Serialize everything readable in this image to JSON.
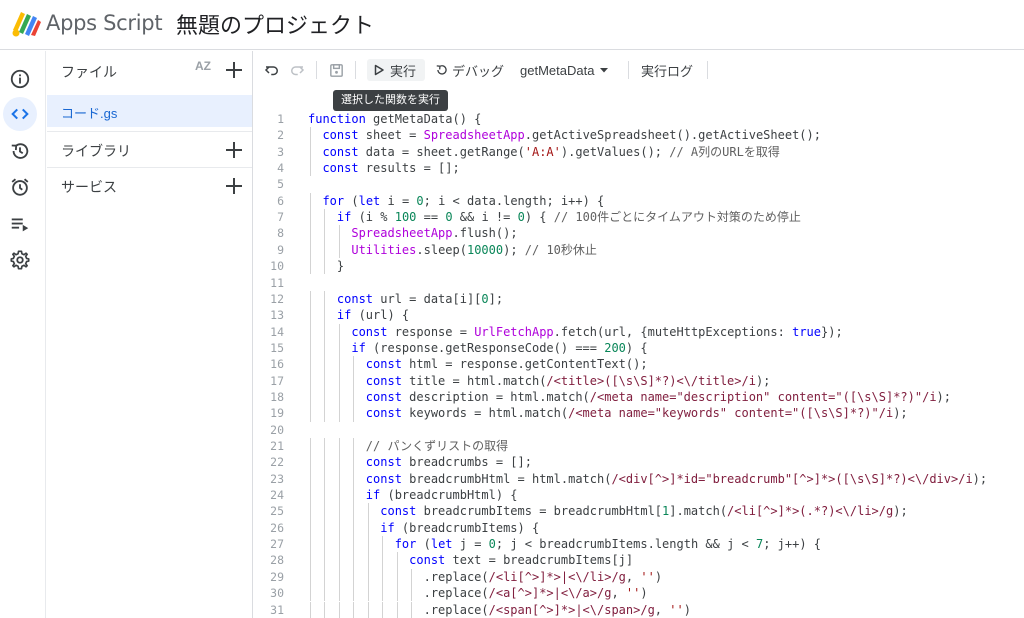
{
  "header": {
    "app_name": "Apps Script",
    "project_title": "無題のプロジェクト"
  },
  "rail": {
    "items": [
      "info-icon",
      "code-icon",
      "history-icon",
      "triggers-icon",
      "executions-icon",
      "settings-icon"
    ],
    "active": "code-icon"
  },
  "files_panel": {
    "title": "ファイル",
    "sort_icon_text": "AZ",
    "files": [
      "コード.gs"
    ],
    "sections": [
      {
        "label": "ライブラリ"
      },
      {
        "label": "サービス"
      }
    ]
  },
  "toolbar": {
    "run_label": "実行",
    "debug_label": "デバッグ",
    "function_name": "getMetaData",
    "log_label": "実行ログ",
    "tooltip": "選択した関数を実行"
  },
  "colors": {
    "accent": "#1a73e8",
    "selected_bg": "#e8f0fe",
    "keyword": "#0000ff",
    "string": "#a31515",
    "comment": "#616161"
  },
  "code": {
    "line_numbers": [
      "1",
      "2",
      "3",
      "4",
      "5",
      "6",
      "7",
      "8",
      "9",
      "10",
      "11",
      "12",
      "13",
      "14",
      "15",
      "16",
      "17",
      "18",
      "19",
      "20",
      "21",
      "22",
      "23",
      "24",
      "25",
      "26",
      "27",
      "28",
      "29",
      "30",
      "31"
    ],
    "lines": [
      "function getMetaData() {",
      "  const sheet = SpreadsheetApp.getActiveSpreadsheet().getActiveSheet();",
      "  const data = sheet.getRange('A:A').getValues(); // A列のURLを取得",
      "  const results = [];",
      "",
      "  for (let i = 0; i < data.length; i++) {",
      "    if (i % 100 == 0 && i != 0) { // 100件ごとにタイムアウト対策のため停止",
      "      SpreadsheetApp.flush();",
      "      Utilities.sleep(10000); // 10秒休止",
      "    }",
      "",
      "    const url = data[i][0];",
      "    if (url) {",
      "      const response = UrlFetchApp.fetch(url, {muteHttpExceptions: true});",
      "      if (response.getResponseCode() === 200) {",
      "        const html = response.getContentText();",
      "        const title = html.match(/<title>([\\s\\S]*?)<\\/title>/i);",
      "        const description = html.match(/<meta name=\"description\" content=\"([\\s\\S]*?)\"/i);",
      "        const keywords = html.match(/<meta name=\"keywords\" content=\"([\\s\\S]*?)\"/i);",
      "",
      "        // パンくずリストの取得",
      "        const breadcrumbs = [];",
      "        const breadcrumbHtml = html.match(/<div[^>]*id=\"breadcrumb\"[^>]*>([\\s\\S]*?)<\\/div>/i);",
      "        if (breadcrumbHtml) {",
      "          const breadcrumbItems = breadcrumbHtml[1].match(/<li[^>]*>(.*?)<\\/li>/g);",
      "          if (breadcrumbItems) {",
      "            for (let j = 0; j < breadcrumbItems.length && j < 7; j++) {",
      "              const text = breadcrumbItems[j]",
      "                .replace(/<li[^>]*>|<\\/li>/g, '')",
      "                .replace(/<a[^>]*>|<\\/a>/g, '')",
      "                .replace(/<span[^>]*>|<\\/span>/g, '')"
    ]
  }
}
